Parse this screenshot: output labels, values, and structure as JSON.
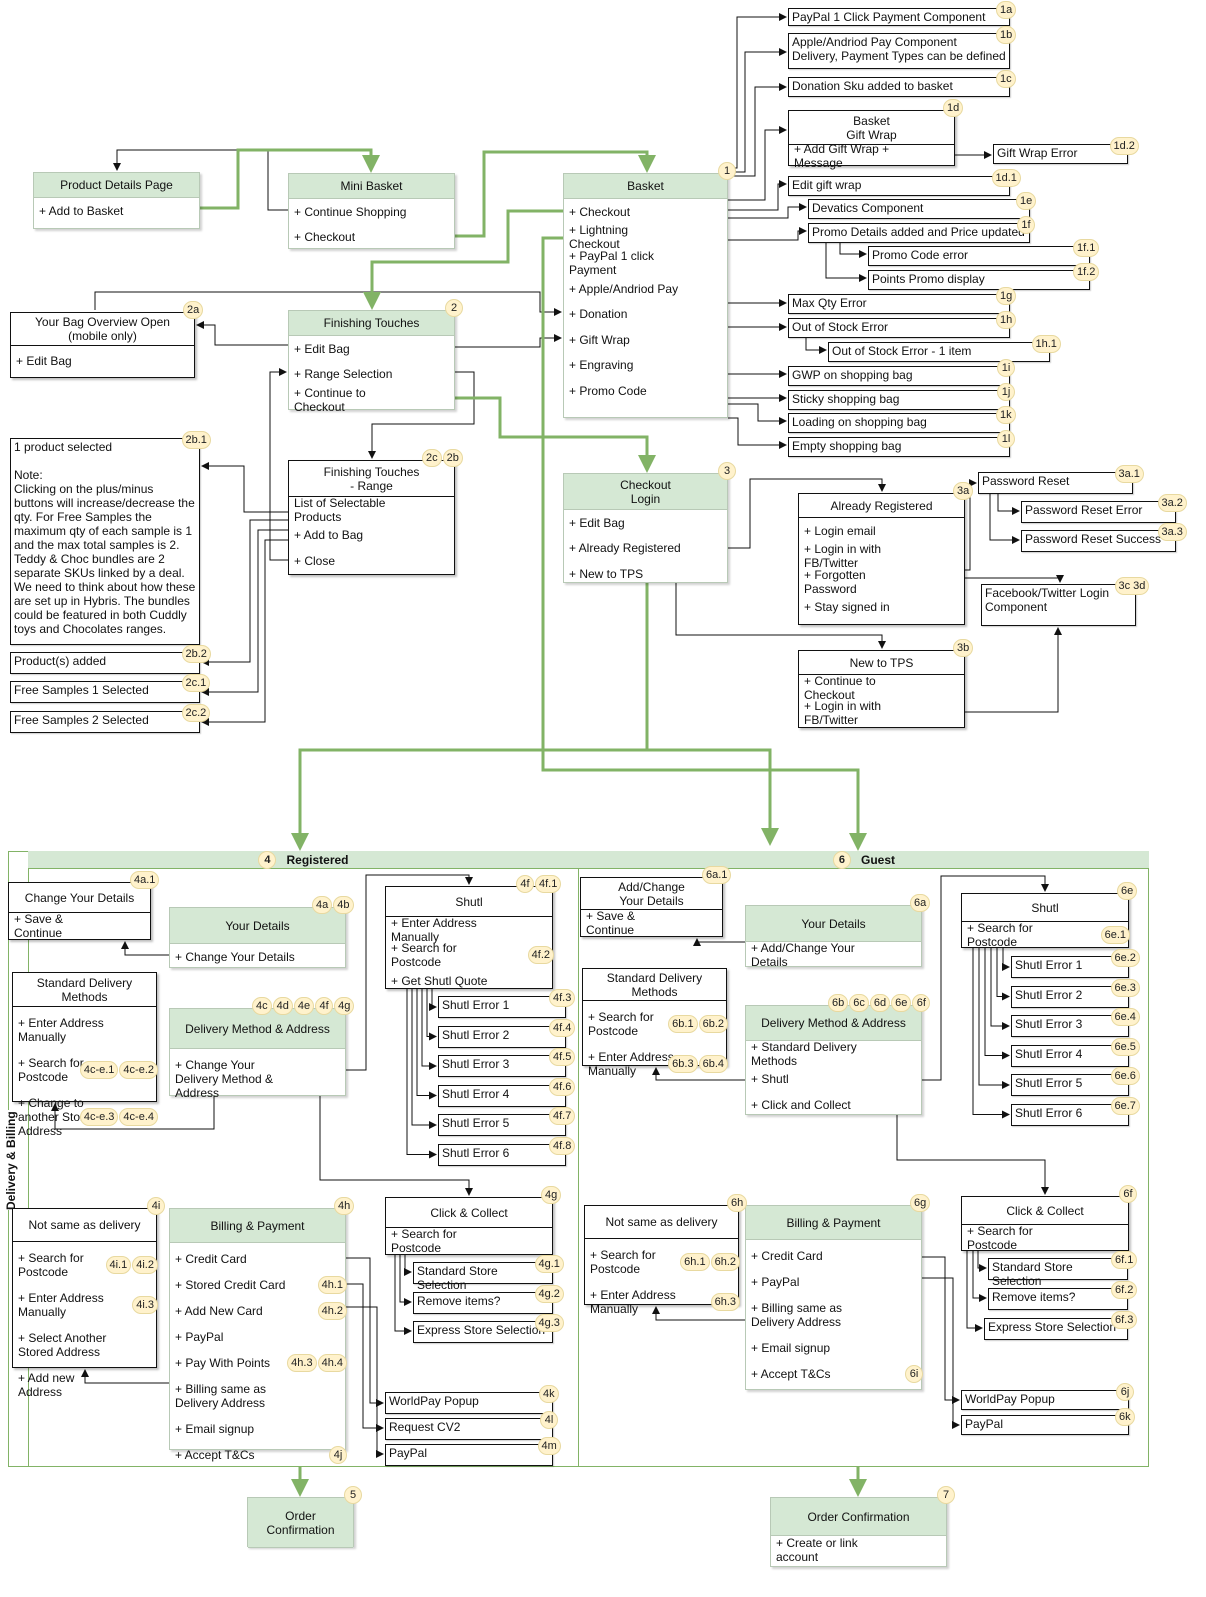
{
  "colors": {
    "header_green": "#d5e8d4",
    "line_green": "#82b366",
    "badge_yellow": "#fff2cc"
  },
  "sections": {
    "registered": {
      "badge": "4",
      "label": "Registered"
    },
    "guest": {
      "badge": "6",
      "label": "Guest"
    },
    "side_label": "Delivery & Billing"
  },
  "nodes": {
    "pdp": {
      "title": "Product Details Page",
      "items": [
        "+ Add to Basket"
      ]
    },
    "mini": {
      "title": "Mini Basket",
      "items": [
        "+ Continue Shopping",
        "+ Checkout"
      ]
    },
    "basket": {
      "title": "Basket",
      "badges": [
        "1"
      ],
      "items": [
        "+ Checkout",
        "+ Lightning Checkout",
        "+ PayPal 1 click Payment",
        "+ Apple/Andriod Pay",
        "+ Donation",
        "+ Gift Wrap",
        "+ Engraving",
        "+ Promo Code"
      ]
    },
    "ft": {
      "title": "Finishing Touches",
      "badges": [
        "2"
      ],
      "items": [
        "+ Edit Bag",
        "+ Range Selection",
        "+ Continue to Checkout"
      ]
    },
    "bagov": {
      "title": "Your Bag Overview Open (mobile only)",
      "badges": [
        "2a"
      ],
      "items": [
        "+ Edit Bag"
      ]
    },
    "ftr": {
      "title": "Finishing Touches\n- Range",
      "badges": [
        "2c",
        "2b"
      ],
      "items": [
        "List of Selectable Products",
        "+ Add to Bag",
        "+ Close"
      ]
    },
    "login": {
      "title": "Checkout\nLogin",
      "badges": [
        "3"
      ],
      "items": [
        "+ Edit Bag",
        "+ Already Registered",
        "+ New to TPS"
      ]
    },
    "already": {
      "title": "Already Registered",
      "badges": [
        "3a"
      ],
      "items": [
        "+ Login email",
        "+ Login in with FB/Twitter",
        "+ Forgotten Password",
        "+ Stay signed in"
      ]
    },
    "newtps": {
      "title": "New to TPS",
      "badges": [
        "3b"
      ],
      "items": [
        "+ Continue to Checkout",
        "+ Login in with FB/Twitter"
      ]
    },
    "gift": {
      "title": "Basket\nGift Wrap",
      "badges": [
        "1d"
      ],
      "items": [
        "+ Add Gift Wrap + Message"
      ]
    },
    "r_change": {
      "title": "Change Your Details",
      "badges": [
        "4a.1"
      ],
      "items": [
        "+ Save & Continue"
      ]
    },
    "r_yd": {
      "title": "Your Details",
      "badges": [
        "4a",
        "4b"
      ],
      "items": [
        "+ Change Your Details"
      ]
    },
    "r_sdm": {
      "title": "Standard Delivery\nMethods",
      "items": [
        "+ Enter Address Manually",
        "+ Search for Postcode",
        "+ Change to another Stored Address"
      ],
      "item_badges": {
        "1": [
          "4c-e.1",
          "4c-e.2"
        ],
        "2": [
          "4c-e.3",
          "4c-e.4"
        ]
      }
    },
    "r_dma": {
      "title": "Delivery Method & Address",
      "badges": [
        "4c",
        "4d",
        "4e",
        "4f",
        "4g"
      ],
      "items": [
        "+ Change Your Delivery Method & Address"
      ]
    },
    "r_shutl": {
      "title": "Shutl",
      "badges": [
        "4f",
        "4f.1"
      ],
      "items": [
        "+ Enter Address Manually",
        "+ Search for Postcode",
        "+ Get Shutl Quote"
      ],
      "item_badges": {
        "1": [
          "4f.2"
        ]
      }
    },
    "r_cc": {
      "title": "Click & Collect",
      "badges": [
        "4g"
      ],
      "items": [
        "+ Search for Postcode"
      ]
    },
    "r_nsd": {
      "title": "Not same as delivery",
      "badges": [
        "4i"
      ],
      "items": [
        "+ Search for Postcode",
        "+ Enter Address Manually",
        "+ Select Another Stored Address",
        "+ Add new Address"
      ],
      "item_badges": {
        "0": [
          "4i.1",
          "4i.2"
        ],
        "1": [
          "4i.3"
        ]
      }
    },
    "r_bp": {
      "title": "Billing & Payment",
      "badges": [
        "4h"
      ],
      "items": [
        "+ Credit Card",
        "+ Stored Credit Card",
        "+ Add New Card",
        "+ PayPal",
        "+ Pay With Points",
        "+ Billing same as Delivery Address",
        "+ Email signup",
        "+ Accept T&Cs"
      ],
      "item_badges": {
        "1": [
          "4h.1"
        ],
        "2": [
          "4h.2"
        ],
        "4": [
          "4h.3",
          "4h.4"
        ],
        "7": [
          "4j"
        ]
      }
    },
    "g_change": {
      "title": "Add/Change\nYour Details",
      "badges": [
        "6a.1"
      ],
      "items": [
        "+ Save & Continue"
      ]
    },
    "g_yd": {
      "title": "Your Details",
      "badges": [
        "6a"
      ],
      "items": [
        "+ Add/Change Your Details"
      ]
    },
    "g_sdm": {
      "title": "Standard Delivery\nMethods",
      "items": [
        "+ Search for Postcode",
        "+ Enter Address Manually"
      ],
      "item_badges": {
        "0": [
          "6b.1",
          "6b.2"
        ],
        "1": [
          "6b.3",
          "6b.4"
        ]
      }
    },
    "g_dma": {
      "title": "Delivery Method & Address",
      "badges": [
        "6b",
        "6c",
        "6d",
        "6e",
        "6f"
      ],
      "items": [
        "+ Standard Delivery Methods",
        "+ Shutl",
        "+ Click and Collect"
      ]
    },
    "g_shutl": {
      "title": "Shutl",
      "badges": [
        "6e"
      ],
      "items": [
        "+ Search for Postcode"
      ],
      "item_badges": {
        "0": [
          "6e.1"
        ]
      }
    },
    "g_cc": {
      "title": "Click & Collect",
      "badges": [
        "6f"
      ],
      "items": [
        "+ Search for Postcode"
      ]
    },
    "g_nsd": {
      "title": "Not same as delivery",
      "badges": [
        "6h"
      ],
      "items": [
        "+ Search for Postcode",
        "+ Enter Address Manually"
      ],
      "item_badges": {
        "0": [
          "6h.1",
          "6h.2"
        ],
        "1": [
          "6h.3"
        ]
      }
    },
    "g_bp": {
      "title": "Billing & Payment",
      "badges": [
        "6g"
      ],
      "items": [
        "+ Credit Card",
        "+ PayPal",
        "+ Billing same as Delivery Address",
        "+ Email signup",
        "+ Accept T&Cs"
      ],
      "item_badges": {
        "4": [
          "6i"
        ]
      }
    },
    "oc5": {
      "title": "Order Confirmation",
      "badges": [
        "5"
      ],
      "items": []
    },
    "oc7": {
      "title": "Order Confirmation",
      "badges": [
        "7"
      ],
      "items": [
        "+ Create or link account"
      ]
    }
  },
  "notes": {
    "n1a": {
      "text": "PayPal 1 Click Payment Component",
      "badge": "1a"
    },
    "n1b": {
      "text": "Apple/Andriod Pay Component\nDelivery, Payment Types can be defined",
      "badge": "1b"
    },
    "n1c": {
      "text": "Donation Sku added to basket",
      "badge": "1c"
    },
    "n1d2": {
      "text": "Gift Wrap Error",
      "badge": "1d.2"
    },
    "n1d1": {
      "text": "Edit gift wrap",
      "badge": "1d.1"
    },
    "n1e": {
      "text": "Devatics Component",
      "badge": "1e"
    },
    "n1f": {
      "text": "Promo Details added and Price updated",
      "badge": "1f"
    },
    "n1f1": {
      "text": "Promo Code error",
      "badge": "1f.1"
    },
    "n1f2": {
      "text": "Points Promo display",
      "badge": "1f.2"
    },
    "n1g": {
      "text": "Max Qty Error",
      "badge": "1g"
    },
    "n1h": {
      "text": "Out of Stock Error",
      "badge": "1h"
    },
    "n1h1": {
      "text": "Out of Stock Error - 1 item",
      "badge": "1h.1"
    },
    "n1i": {
      "text": "GWP on shopping bag",
      "badge": "1i"
    },
    "n1j": {
      "text": "Sticky shopping bag",
      "badge": "1j"
    },
    "n1k": {
      "text": "Loading on shopping bag",
      "badge": "1k"
    },
    "n1l": {
      "text": "Empty shopping bag",
      "badge": "1l"
    },
    "n2b1": {
      "text": "1 product selected\n\nNote:\nClicking on the plus/minus buttons will increase/decrease the qty. For Free Samples the maximum qty of each sample is 1 and the max total samples is 2.\nTeddy & Choc bundles are 2 separate SKUs linked by a deal. We need to think about how these are set up in Hybris. The bundles could be featured in both Cuddly toys and Chocolates ranges.",
      "badge": "2b.1"
    },
    "n2b2": {
      "text": "Product(s) added",
      "badge": "2b.2"
    },
    "n2c1": {
      "text": "Free Samples 1 Selected",
      "badge": "2c.1"
    },
    "n2c2": {
      "text": "Free Samples 2 Selected",
      "badge": "2c.2"
    },
    "n3a1": {
      "text": "Password Reset",
      "badge": "3a.1"
    },
    "n3a2": {
      "text": "Password Reset Error",
      "badge": "3a.2"
    },
    "n3a3": {
      "text": "Password Reset Success",
      "badge": "3a.3"
    },
    "n3c": {
      "text": "Facebook/Twitter Login\nComponent",
      "badge": "3c 3d"
    },
    "r_e1": {
      "text": "Shutl Error 1",
      "badge": "4f.3"
    },
    "r_e2": {
      "text": "Shutl Error 2",
      "badge": "4f.4"
    },
    "r_e3": {
      "text": "Shutl Error 3",
      "badge": "4f.5"
    },
    "r_e4": {
      "text": "Shutl Error 4",
      "badge": "4f.6"
    },
    "r_e5": {
      "text": "Shutl Error 5",
      "badge": "4f.7"
    },
    "r_e6": {
      "text": "Shutl Error 6",
      "badge": "4f.8"
    },
    "r_s1": {
      "text": "Standard Store Selection",
      "badge": "4g.1"
    },
    "r_s2": {
      "text": "Remove items?",
      "badge": "4g.2"
    },
    "r_s3": {
      "text": "Express Store Selection",
      "badge": "4g.3"
    },
    "r_wp": {
      "text": "WorldPay Popup",
      "badge": "4k"
    },
    "r_cv": {
      "text": "Request CV2",
      "badge": "4l"
    },
    "r_pp": {
      "text": "PayPal",
      "badge": "4m"
    },
    "g_e1": {
      "text": "Shutl Error 1",
      "badge": "6e.2"
    },
    "g_e2": {
      "text": "Shutl Error 2",
      "badge": "6e.3"
    },
    "g_e3": {
      "text": "Shutl Error 3",
      "badge": "6e.4"
    },
    "g_e4": {
      "text": "Shutl Error 4",
      "badge": "6e.5"
    },
    "g_e5": {
      "text": "Shutl Error 5",
      "badge": "6e.6"
    },
    "g_e6": {
      "text": "Shutl Error 6",
      "badge": "6e.7"
    },
    "g_s1": {
      "text": "Standard Store Selection",
      "badge": "6f.1"
    },
    "g_s2": {
      "text": "Remove items?",
      "badge": "6f.2"
    },
    "g_s3": {
      "text": "Express Store Selection",
      "badge": "6f.3"
    },
    "g_wp": {
      "text": "WorldPay Popup",
      "badge": "6j"
    },
    "g_pp": {
      "text": "PayPal",
      "badge": "6k"
    }
  }
}
